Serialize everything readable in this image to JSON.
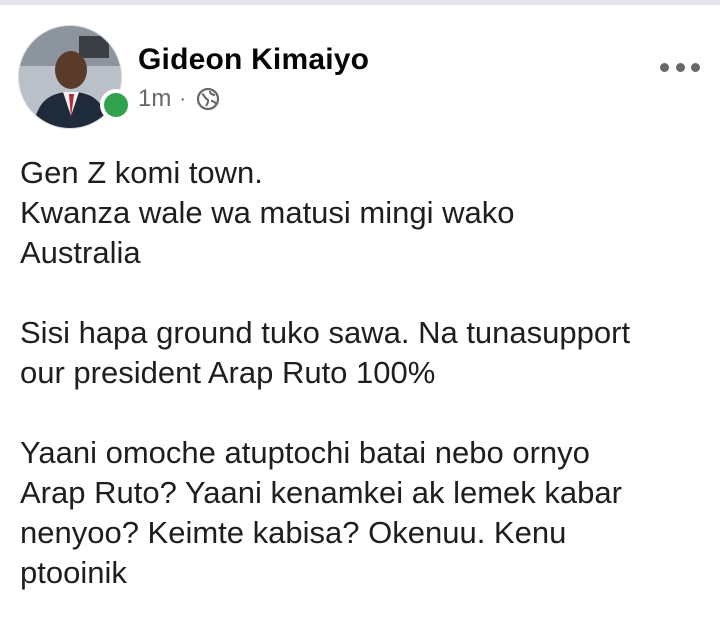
{
  "post": {
    "author": "Gideon Kimaiyo",
    "timestamp": "1m",
    "separator": "·",
    "privacy_icon": "globe-icon",
    "more_icon": "more-horizontal-icon",
    "online": true,
    "paragraphs": [
      [
        "Gen Z komi town.",
        "Kwanza wale wa matusi mingi wako",
        "Australia"
      ],
      [
        "Sisi hapa ground tuko sawa. Na tunasupport",
        "our president Arap Ruto 100%"
      ],
      [
        "Yaani omoche atuptochi batai nebo ornyo",
        "Arap Ruto? Yaani kenamkei ak lemek kabar",
        "nenyoo? Keimte kabisa? Okenuu. Kenu",
        "ptooinik"
      ]
    ]
  },
  "colors": {
    "online": "#31a24c",
    "meta_text": "#65676b",
    "body_text": "#1c1e21"
  }
}
